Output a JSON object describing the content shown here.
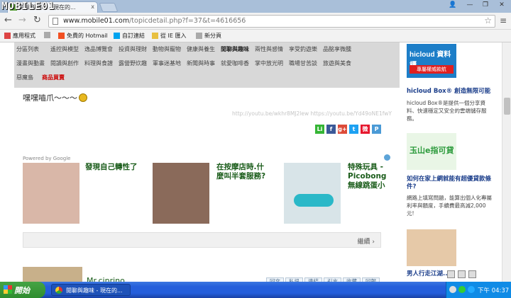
{
  "window": {
    "logo_text": "MOBILE01",
    "tab_title": "閒聊與趣味 - 現在的...",
    "tab_close": "x",
    "controls": {
      "user": "👤",
      "minimize": "—",
      "maximize": "❐",
      "close": "✕"
    }
  },
  "address": {
    "host": "www.mobile01.com",
    "path": "/topicdetail.php?f=37&t=4616656"
  },
  "bookmarks": [
    {
      "label": "應用程式",
      "color": "#d44"
    },
    {
      "label": "",
      "color": "#aaa"
    },
    {
      "label": "免費的 Hotmail",
      "color": "#f25022"
    },
    {
      "label": "自訂連結",
      "color": "#00a4ef"
    },
    {
      "label": "從 IE 匯入",
      "color": "#e8c040"
    },
    {
      "label": "新分頁",
      "color": "#aaa"
    }
  ],
  "categories": {
    "row1": [
      "分區列表",
      "遙控與模型",
      "逸品博覽會",
      "投資與理財",
      "動物與寵物",
      "健康與養生",
      "閒聊與趣味",
      "兩性與感情",
      "享受釣遊樂",
      "品酩享微醺"
    ],
    "row2": [
      "漫畫與動畫",
      "閱讀與創作",
      "料理與食譜",
      "露營野炊趣",
      "軍事迷基地",
      "新聞與時事",
      "就愛咖啡香",
      "掌中放光明",
      "職場甘苦談",
      "旅遊與美食"
    ],
    "row3": [
      "惡魔島",
      "商品買賣"
    ]
  },
  "post": {
    "text": "嘿嘿嚙爪～～～",
    "ghost_url": "http://youtu.be/wkhr8MJ2lew https://youtu.be/Yd49oNE1fwY",
    "share": [
      {
        "name": "line",
        "label": "Li",
        "color": "#35b535"
      },
      {
        "name": "facebook",
        "label": "f",
        "color": "#3b5998"
      },
      {
        "name": "google-plus",
        "label": "g+",
        "color": "#dd4b39"
      },
      {
        "name": "twitter",
        "label": "t",
        "color": "#1da1f2"
      },
      {
        "name": "weibo",
        "label": "微",
        "color": "#e6162d"
      },
      {
        "name": "plurk",
        "label": "P",
        "color": "#4a9ad6"
      }
    ]
  },
  "ads": {
    "powered_by": "Powered by Google",
    "items": [
      {
        "title": "發現自己轉性了",
        "color": "#d9b7a8"
      },
      {
        "title": "在按摩店時.什麼叫半套服務?",
        "color": "#8a6a5a"
      },
      {
        "title": "特殊玩具 -Picobong 無線跳蛋小",
        "color": "#d8e4e8"
      }
    ],
    "more_label": "繼續 ›"
  },
  "author": {
    "name": "Mr.cinrino",
    "actions": [
      "回文",
      "私訊",
      "連結",
      "引言",
      "收藏",
      "回報"
    ]
  },
  "sidebar": {
    "hicloud": {
      "brand": "hicloud 資料櫃",
      "badge": "專屬權威款航",
      "title": "hicloud Box® 創造無限可能",
      "body": "hicloud Box®是提供一個分享資料、快速穩定又安全的雲端儲存服務。"
    },
    "yushan": {
      "brand": "玉山e指可貸",
      "title": "如何在家上網就能有超優貸款條件?",
      "body": "網路上填寫問題，能算出個人化專屬利率與額度，手續費最高減2,000元!"
    },
    "man": {
      "title": "男人行走江湖..."
    }
  },
  "taskbar": {
    "start_label": "開始",
    "task_label": "閒聊與趣味 - 現在的...",
    "clock": "下午 04:37"
  }
}
